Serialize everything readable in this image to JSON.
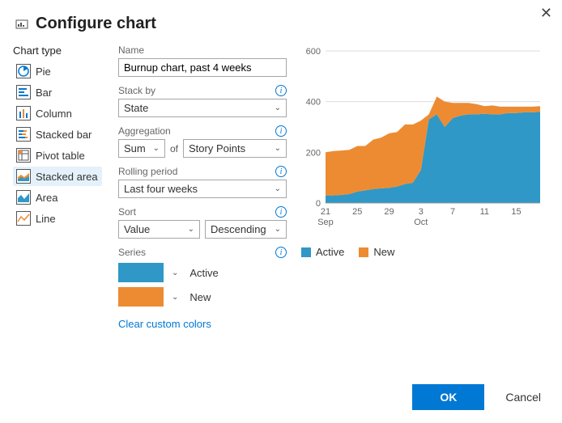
{
  "dialog": {
    "title": "Configure chart",
    "ok": "OK",
    "cancel": "Cancel"
  },
  "sidebar": {
    "title": "Chart type",
    "items": [
      {
        "label": "Pie"
      },
      {
        "label": "Bar"
      },
      {
        "label": "Column"
      },
      {
        "label": "Stacked bar"
      },
      {
        "label": "Pivot table"
      },
      {
        "label": "Stacked area"
      },
      {
        "label": "Area"
      },
      {
        "label": "Line"
      }
    ],
    "selected": "Stacked area"
  },
  "form": {
    "name_label": "Name",
    "name_value": "Burnup chart, past 4 weeks",
    "stackby_label": "Stack by",
    "stackby_value": "State",
    "aggregation_label": "Aggregation",
    "aggregation_func": "Sum",
    "aggregation_of": "of",
    "aggregation_field": "Story Points",
    "rolling_label": "Rolling period",
    "rolling_value": "Last four weeks",
    "sort_label": "Sort",
    "sort_field": "Value",
    "sort_dir": "Descending",
    "series_label": "Series",
    "series": [
      {
        "label": "Active",
        "color": "#2f98c6"
      },
      {
        "label": "New",
        "color": "#ed8b32"
      }
    ],
    "clear_colors": "Clear custom colors"
  },
  "legend": {
    "items": [
      {
        "label": "Active",
        "color": "#2f98c6"
      },
      {
        "label": "New",
        "color": "#ed8b32"
      }
    ]
  },
  "chart_data": {
    "type": "area",
    "title": "",
    "xlabel": "",
    "ylabel": "",
    "ylim": [
      0,
      600
    ],
    "yticks": [
      0,
      200,
      400,
      600
    ],
    "x": [
      "21 Sep",
      "22",
      "23",
      "24",
      "25",
      "26",
      "27",
      "28",
      "29",
      "30",
      "1",
      "2",
      "3 Oct",
      "4",
      "5",
      "6",
      "7",
      "8",
      "9",
      "10",
      "11",
      "12",
      "13",
      "14",
      "15",
      "16",
      "17",
      "18"
    ],
    "xtick_labels_top": [
      "21",
      "25",
      "29",
      "3",
      "7",
      "11",
      "15"
    ],
    "xtick_labels_bottom": [
      "Sep",
      "",
      "",
      "Oct",
      "",
      "",
      ""
    ],
    "series": [
      {
        "name": "Active",
        "color": "#2f98c6",
        "values": [
          30,
          30,
          32,
          35,
          45,
          50,
          55,
          58,
          60,
          65,
          75,
          80,
          130,
          330,
          350,
          300,
          335,
          345,
          350,
          350,
          352,
          350,
          350,
          355,
          355,
          358,
          358,
          360
        ]
      },
      {
        "name": "New",
        "color": "#ed8b32",
        "values": [
          170,
          175,
          175,
          175,
          180,
          175,
          195,
          200,
          215,
          215,
          235,
          230,
          195,
          20,
          70,
          100,
          60,
          50,
          45,
          40,
          30,
          35,
          30,
          25,
          25,
          22,
          22,
          22
        ]
      }
    ]
  }
}
